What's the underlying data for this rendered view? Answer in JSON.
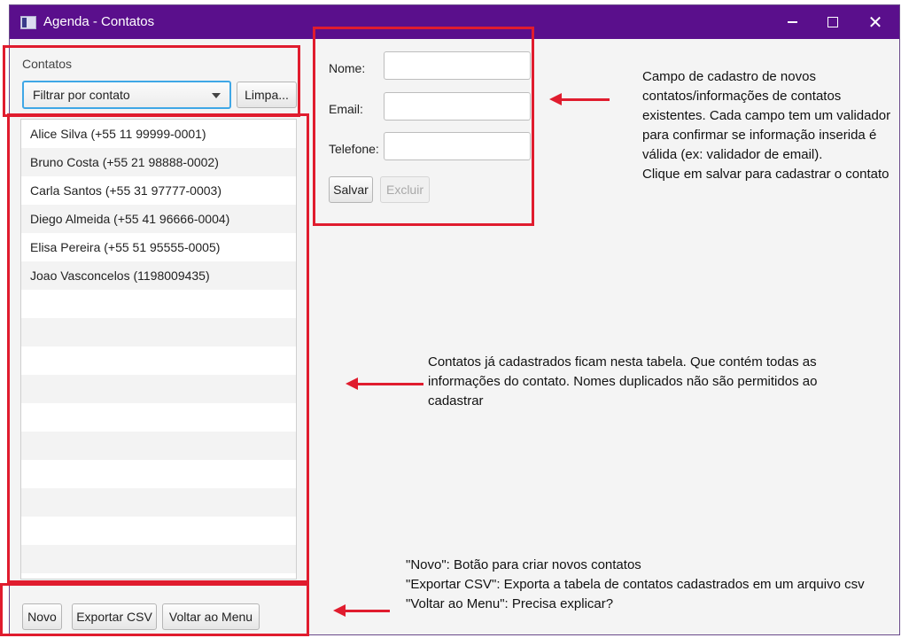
{
  "window": {
    "title": "Agenda - Contatos"
  },
  "left_panel": {
    "label": "Contatos",
    "filter_placeholder": "Filtrar por contato",
    "clear_button": "Limpa...",
    "contacts": [
      "Alice Silva (+55 11 99999-0001)",
      "Bruno Costa (+55 21 98888-0002)",
      "Carla Santos (+55 31 97777-0003)",
      "Diego Almeida (+55 41 96666-0004)",
      "Elisa Pereira (+55 51 95555-0005)",
      "Joao Vasconcelos (1198009435)"
    ]
  },
  "form": {
    "name_label": "Nome:",
    "email_label": "Email:",
    "phone_label": "Telefone:",
    "save_button": "Salvar",
    "delete_button": "Excluir"
  },
  "bottom_bar": {
    "new_button": "Novo",
    "export_button": "Exportar CSV",
    "back_button": "Voltar ao Menu"
  },
  "annotations": {
    "form_note": "Campo de cadastro de novos\ncontatos/informações de contatos\nexistentes. Cada campo tem um validador\npara confirmar se informação inserida é\nválida (ex: validador de email).\nClique em salvar para cadastrar o contato",
    "table_note": "Contatos já cadastrados ficam nesta tabela. Que contém todas as\ninformações do contato. Nomes duplicados não são permitidos ao\ncadastrar",
    "buttons_note": "\"Novo\": Botão para criar novos contatos\n\"Exportar CSV\": Exporta a tabela de contatos cadastrados em um arquivo csv\n\"Voltar ao Menu\": Precisa explicar?"
  },
  "colors": {
    "titlebar": "#5a0f8c",
    "highlight_red": "#e01c2e",
    "focus_blue": "#3fa7e6"
  }
}
